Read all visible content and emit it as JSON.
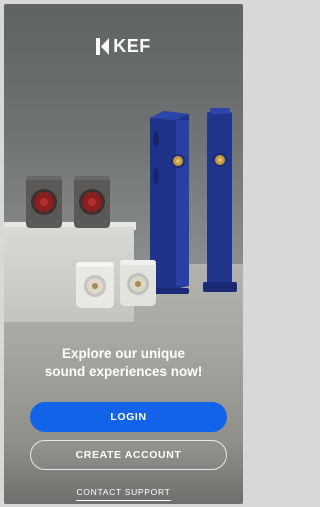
{
  "brand": {
    "name": "KEF"
  },
  "hero": {
    "tagline_line1": "Explore our unique",
    "tagline_line2": "sound experiences now!"
  },
  "actions": {
    "login_label": "LOGIN",
    "create_account_label": "CREATE ACCOUNT",
    "contact_support_label": "CONTACT SUPPORT"
  },
  "colors": {
    "primary": "#1262ea",
    "text": "#ffffff"
  },
  "icons": {
    "brand_logo": "kef-logo-icon"
  }
}
